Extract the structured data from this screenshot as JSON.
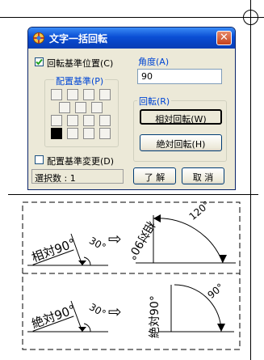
{
  "dialog": {
    "title": "文字一括回転",
    "rotate_base_checkbox": {
      "label": "回転基準位置(C)",
      "checked": true
    },
    "arrange_base_label": "配置基準(P)",
    "arrange_base_change_checkbox": {
      "label": "配置基準変更(D)",
      "checked": false
    },
    "selection_count": "選択数 : 1",
    "angle_label": "角度(A)",
    "angle_value": "90",
    "rotation_group_label": "回転(R)",
    "relative_rotation_button": "相対回転(W)",
    "absolute_rotation_button": "絶対回転(H)",
    "ok_button": "了 解",
    "cancel_button": "取 消"
  },
  "diagram": {
    "top": {
      "before_text": "相対90°",
      "before_angle": "30°",
      "after_text": "相対90°",
      "after_angle": "120°"
    },
    "bottom": {
      "before_text": "絶対90°",
      "before_angle": "30°",
      "after_text": "絶対90°",
      "after_angle": "90°"
    }
  }
}
